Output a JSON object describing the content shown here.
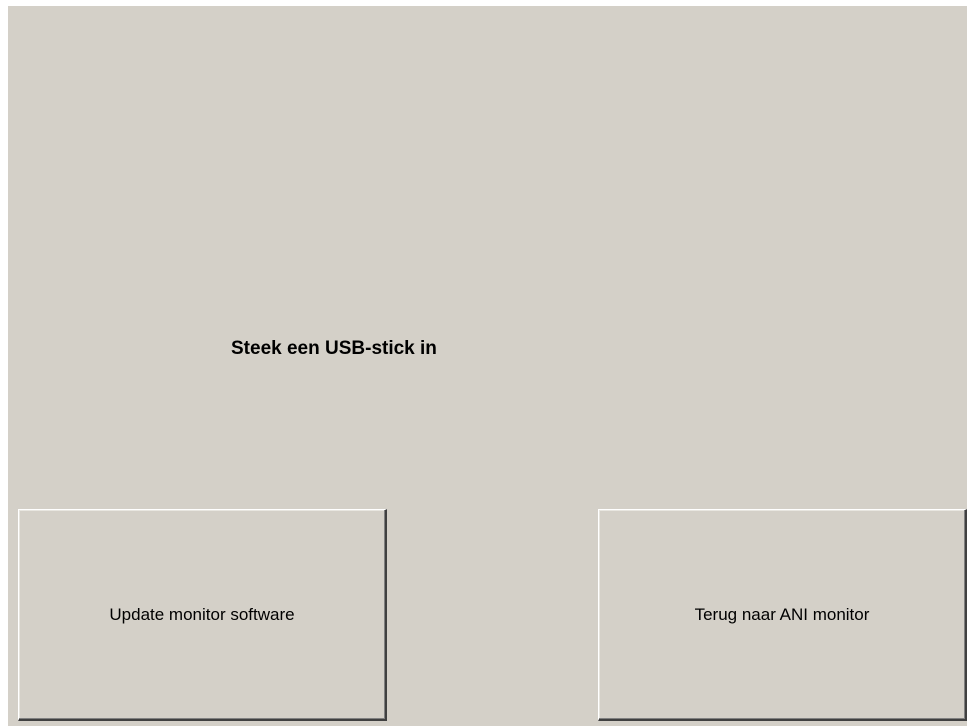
{
  "screen": {
    "message": "Steek een USB-stick in"
  },
  "buttons": {
    "update_label": "Update monitor software",
    "back_label": "Terug naar ANI monitor"
  },
  "colors": {
    "panel_background": "#d4d0c8",
    "text": "#000000"
  }
}
